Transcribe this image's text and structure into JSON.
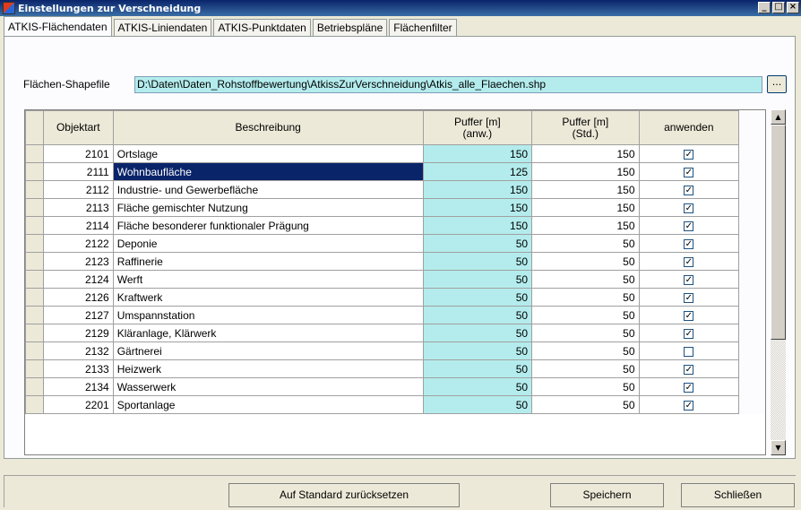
{
  "window": {
    "title": "Einstellungen zur Verschneidung"
  },
  "tabs": [
    {
      "label": "ATKIS-Flächendaten"
    },
    {
      "label": "ATKIS-Liniendaten"
    },
    {
      "label": "ATKIS-Punktdaten"
    },
    {
      "label": "Betriebspläne"
    },
    {
      "label": "Flächenfilter"
    }
  ],
  "shapefile": {
    "label": "Flächen-Shapefile",
    "value": "D:\\Daten\\Daten_Rohstoffbewertung\\AtkissZurVerschneidung\\Atkis_alle_Flaechen.shp",
    "browse_label": "..."
  },
  "grid": {
    "headers": [
      "Objektart",
      "Beschreibung",
      "Puffer [m]\n(anw.)",
      "Puffer [m]\n(Std.)",
      "anwenden"
    ],
    "header_puffer_label": "Puffer [m]",
    "header_anw_sub": "(anw.)",
    "header_std_sub": "(Std.)",
    "rows": [
      {
        "objektart": "2101",
        "beschreibung": "Ortslage",
        "anw": "150",
        "std": "150",
        "anwenden": true
      },
      {
        "objektart": "2111",
        "beschreibung": "Wohnbaufläche",
        "anw": "125",
        "std": "150",
        "anwenden": true,
        "selected": true
      },
      {
        "objektart": "2112",
        "beschreibung": "Industrie- und Gewerbefläche",
        "anw": "150",
        "std": "150",
        "anwenden": true
      },
      {
        "objektart": "2113",
        "beschreibung": "Fläche gemischter Nutzung",
        "anw": "150",
        "std": "150",
        "anwenden": true
      },
      {
        "objektart": "2114",
        "beschreibung": "Fläche besonderer funktionaler Prägung",
        "anw": "150",
        "std": "150",
        "anwenden": true
      },
      {
        "objektart": "2122",
        "beschreibung": "Deponie",
        "anw": "50",
        "std": "50",
        "anwenden": true
      },
      {
        "objektart": "2123",
        "beschreibung": "Raffinerie",
        "anw": "50",
        "std": "50",
        "anwenden": true
      },
      {
        "objektart": "2124",
        "beschreibung": "Werft",
        "anw": "50",
        "std": "50",
        "anwenden": true
      },
      {
        "objektart": "2126",
        "beschreibung": "Kraftwerk",
        "anw": "50",
        "std": "50",
        "anwenden": true
      },
      {
        "objektart": "2127",
        "beschreibung": "Umspannstation",
        "anw": "50",
        "std": "50",
        "anwenden": true
      },
      {
        "objektart": "2129",
        "beschreibung": "Kläranlage, Klärwerk",
        "anw": "50",
        "std": "50",
        "anwenden": true
      },
      {
        "objektart": "2132",
        "beschreibung": "Gärtnerei",
        "anw": "50",
        "std": "50",
        "anwenden": false
      },
      {
        "objektart": "2133",
        "beschreibung": "Heizwerk",
        "anw": "50",
        "std": "50",
        "anwenden": true
      },
      {
        "objektart": "2134",
        "beschreibung": "Wasserwerk",
        "anw": "50",
        "std": "50",
        "anwenden": true
      },
      {
        "objektart": "2201",
        "beschreibung": "Sportanlage",
        "anw": "50",
        "std": "50",
        "anwenden": true
      }
    ]
  },
  "footer": {
    "reset_label": "Auf Standard zurücksetzen",
    "save_label": "Speichern",
    "close_label": "Schließen"
  },
  "colors": {
    "editable_cell": "#b4eced",
    "selection": "#0a246a",
    "titlebar": "#0a246a"
  }
}
